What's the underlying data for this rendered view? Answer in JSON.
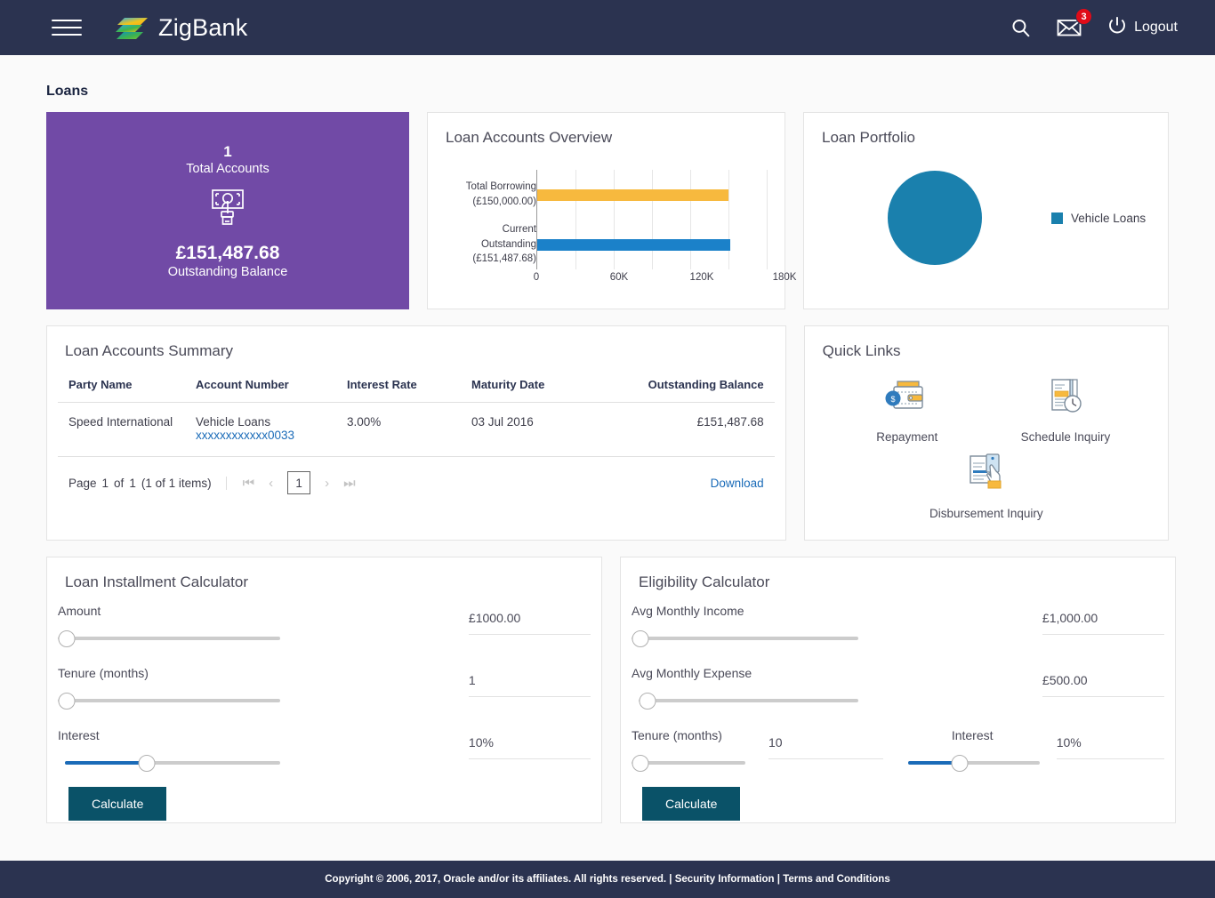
{
  "header": {
    "brand": "ZigBank",
    "menu_icon": "hamburger-icon",
    "search_icon": "search-icon",
    "mail_icon": "mail-icon",
    "mail_badge": "3",
    "logout_label": "Logout",
    "power_icon": "power-icon",
    "background": "#2b3350"
  },
  "page": {
    "title": "Loans"
  },
  "summary_tile": {
    "count": "1",
    "count_label": "Total Accounts",
    "icon": "cash-in-hand-icon",
    "amount": "£151,487.68",
    "amount_label": "Outstanding Balance",
    "color": "#714aa6"
  },
  "overview": {
    "title": "Loan Accounts Overview"
  },
  "portfolio": {
    "title": "Loan Portfolio"
  },
  "summary_table": {
    "title": "Loan Accounts Summary",
    "columns": [
      "Party Name",
      "Account Number",
      "Interest Rate",
      "Maturity Date",
      "Outstanding Balance"
    ],
    "rows": [
      {
        "party_name": "Speed International",
        "account_type": "Vehicle Loans",
        "account_number": "xxxxxxxxxxxx0033",
        "interest_rate": "3.00%",
        "maturity_date": "03 Jul 2016",
        "outstanding_balance": "£151,487.68"
      }
    ],
    "pager": {
      "page_word": "Page",
      "current": "1",
      "of_word": "of",
      "total_pages": "1",
      "items_text": "(1 of 1 items)",
      "first_icon": "first-page-icon",
      "prev_icon": "prev-page-icon",
      "page_box": "1",
      "next_icon": "next-page-icon",
      "last_icon": "last-page-icon",
      "download_label": "Download"
    }
  },
  "quick_links": {
    "title": "Quick Links",
    "items": [
      {
        "label": "Repayment",
        "icon": "wallet-money-icon"
      },
      {
        "label": "Schedule Inquiry",
        "icon": "document-clock-icon"
      },
      {
        "label": "Disbursement Inquiry",
        "icon": "hand-document-icon"
      }
    ]
  },
  "installment_calculator": {
    "title": "Loan Installment Calculator",
    "fields": [
      {
        "label": "Amount",
        "value": "£1000.00",
        "slider_pct": 0
      },
      {
        "label": "Tenure (months)",
        "value": "1",
        "slider_pct": 0
      },
      {
        "label": "Interest",
        "value": "10%",
        "slider_pct": 38
      }
    ],
    "button_label": "Calculate"
  },
  "eligibility_calculator": {
    "title": "Eligibility Calculator",
    "fields": [
      {
        "label": "Avg Monthly Income",
        "value": "£1,000.00",
        "slider_pct": 0
      },
      {
        "label": "Avg Monthly Expense",
        "value": "£500.00",
        "slider_pct": 3
      }
    ],
    "tenure": {
      "label": "Tenure (months)",
      "value": "10",
      "slider_pct": 0
    },
    "interest": {
      "label": "Interest",
      "value": "10%",
      "slider_pct": 38
    },
    "button_label": "Calculate"
  },
  "footer": {
    "copyright": "Copyright © 2006, 2017, Oracle and/or its affiliates. All rights reserved. |",
    "security_link": "Security Information",
    "separator": "|",
    "terms_link": "Terms and Conditions"
  },
  "colors": {
    "navy": "#2b3350",
    "purple": "#714aa6",
    "blue": "#1a80ad",
    "bar_blue": "#1b81c9",
    "bar_orange": "#f7b93e",
    "teal_button": "#0a5268",
    "link": "#1a6bb8"
  },
  "chart_data": [
    {
      "type": "bar",
      "title": "Loan Accounts Overview",
      "orientation": "horizontal",
      "categories": [
        "Total Borrowing\n(£150,000.00)",
        "Current Outstanding\n(£151,487.68)"
      ],
      "category_labels": [
        {
          "line1": "Total Borrowing",
          "line2": "(£150,000.00)"
        },
        {
          "line1": "Current",
          "line2": "Outstanding",
          "line3": "(£151,487.68)"
        }
      ],
      "values": [
        150000,
        151487.68
      ],
      "colors": [
        "#f7b93e",
        "#1b81c9"
      ],
      "xlabel": "",
      "ylabel": "",
      "xlim": [
        0,
        180000
      ],
      "xticks": [
        0,
        60000,
        120000,
        180000
      ],
      "xtick_labels": [
        "0",
        "60K",
        "120K",
        "180K"
      ],
      "minor_gridlines": [
        30000,
        90000,
        150000
      ],
      "grid": true,
      "legend": false
    },
    {
      "type": "pie",
      "title": "Loan Portfolio",
      "labels": [
        "Vehicle Loans"
      ],
      "values": [
        100
      ],
      "colors": [
        "#1a80ad"
      ],
      "legend": true,
      "legend_position": "right"
    }
  ]
}
